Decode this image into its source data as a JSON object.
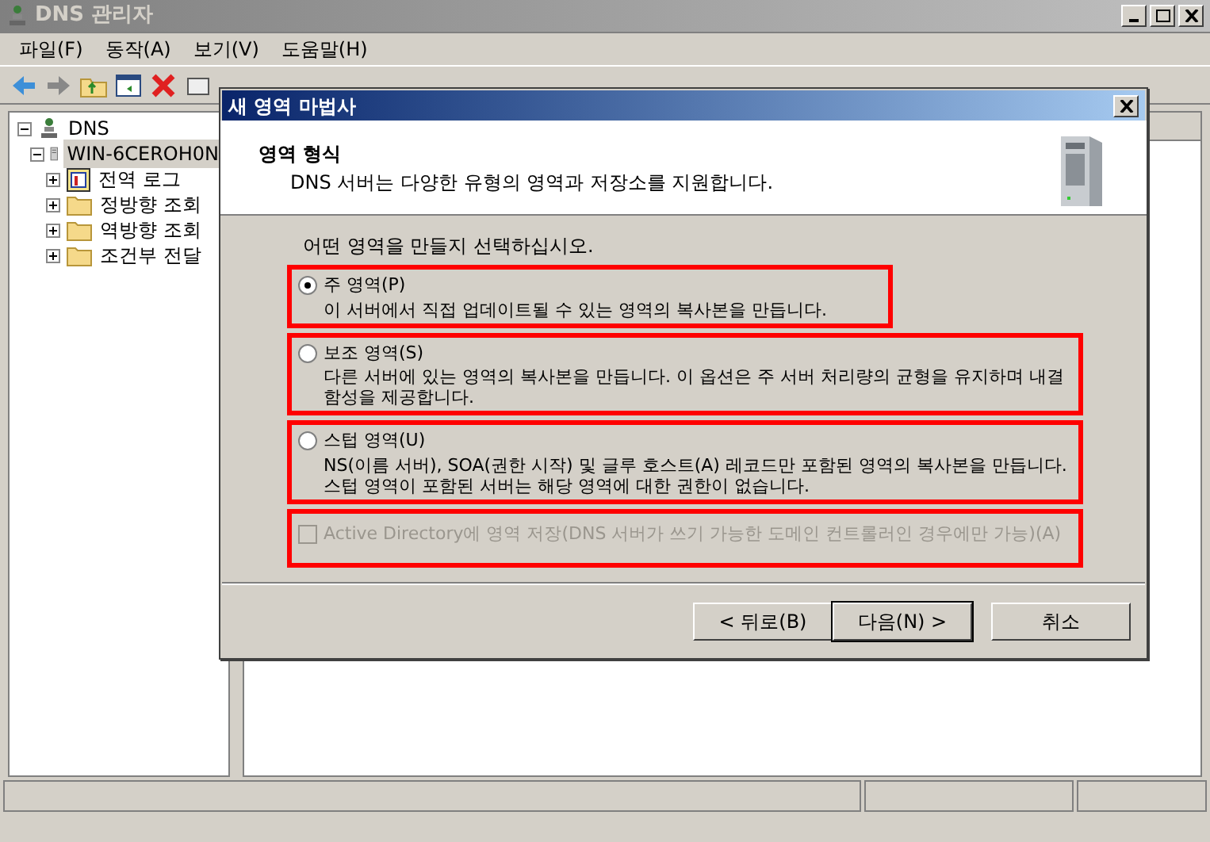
{
  "window": {
    "title": "DNS 관리자"
  },
  "menu": [
    "파일(F)",
    "동작(A)",
    "보기(V)",
    "도움말(H)"
  ],
  "tree": [
    {
      "label": "DNS",
      "kind": "dns",
      "expanded": true,
      "selected": false,
      "children": [
        {
          "label": "WIN-6CEROH0N",
          "kind": "server",
          "expanded": true,
          "selected": true,
          "children": [
            {
              "label": "전역 로그",
              "kind": "log",
              "expanded": false,
              "selected": false
            },
            {
              "label": "정방향 조회",
              "kind": "folder",
              "expanded": false,
              "selected": false
            },
            {
              "label": "역방향 조회",
              "kind": "folder",
              "expanded": false,
              "selected": false
            },
            {
              "label": "조건부 전달",
              "kind": "folder",
              "expanded": false,
              "selected": false
            }
          ]
        }
      ]
    }
  ],
  "dialog": {
    "title": "새 영역 마법사",
    "header_title": "영역 형식",
    "header_subtitle": "DNS 서버는 다양한 유형의 영역과 저장소를 지원합니다.",
    "prompt": "어떤 영역을 만들지 선택하십시오.",
    "options": [
      {
        "kind": "radio",
        "label": "주 영역(P)",
        "description": "이 서버에서 직접 업데이트될 수 있는 영역의 복사본을 만듭니다.",
        "selected": true,
        "disabled": false,
        "highlighted": true
      },
      {
        "kind": "radio",
        "label": "보조 영역(S)",
        "description": "다른 서버에 있는 영역의 복사본을 만듭니다. 이 옵션은 주 서버 처리량의 균형을 유지하며 내결함성을 제공합니다.",
        "selected": false,
        "disabled": false,
        "highlighted": true
      },
      {
        "kind": "radio",
        "label": "스텁 영역(U)",
        "description": "NS(이름 서버), SOA(권한 시작) 및 글루 호스트(A) 레코드만 포함된 영역의 복사본을 만듭니다. 스텁 영역이 포함된 서버는 해당 영역에 대한 권한이 없습니다.",
        "selected": false,
        "disabled": false,
        "highlighted": true
      },
      {
        "kind": "checkbox",
        "label": "Active Directory에 영역 저장(DNS 서버가 쓰기 가능한 도메인 컨트롤러인 경우에만 가능)(A)",
        "checked": false,
        "disabled": true,
        "highlighted": true
      }
    ],
    "buttons": [
      {
        "label": "< 뒤로(B)",
        "default": false
      },
      {
        "label": "다음(N) >",
        "default": true
      },
      {
        "label": "취소",
        "default": false
      }
    ]
  }
}
